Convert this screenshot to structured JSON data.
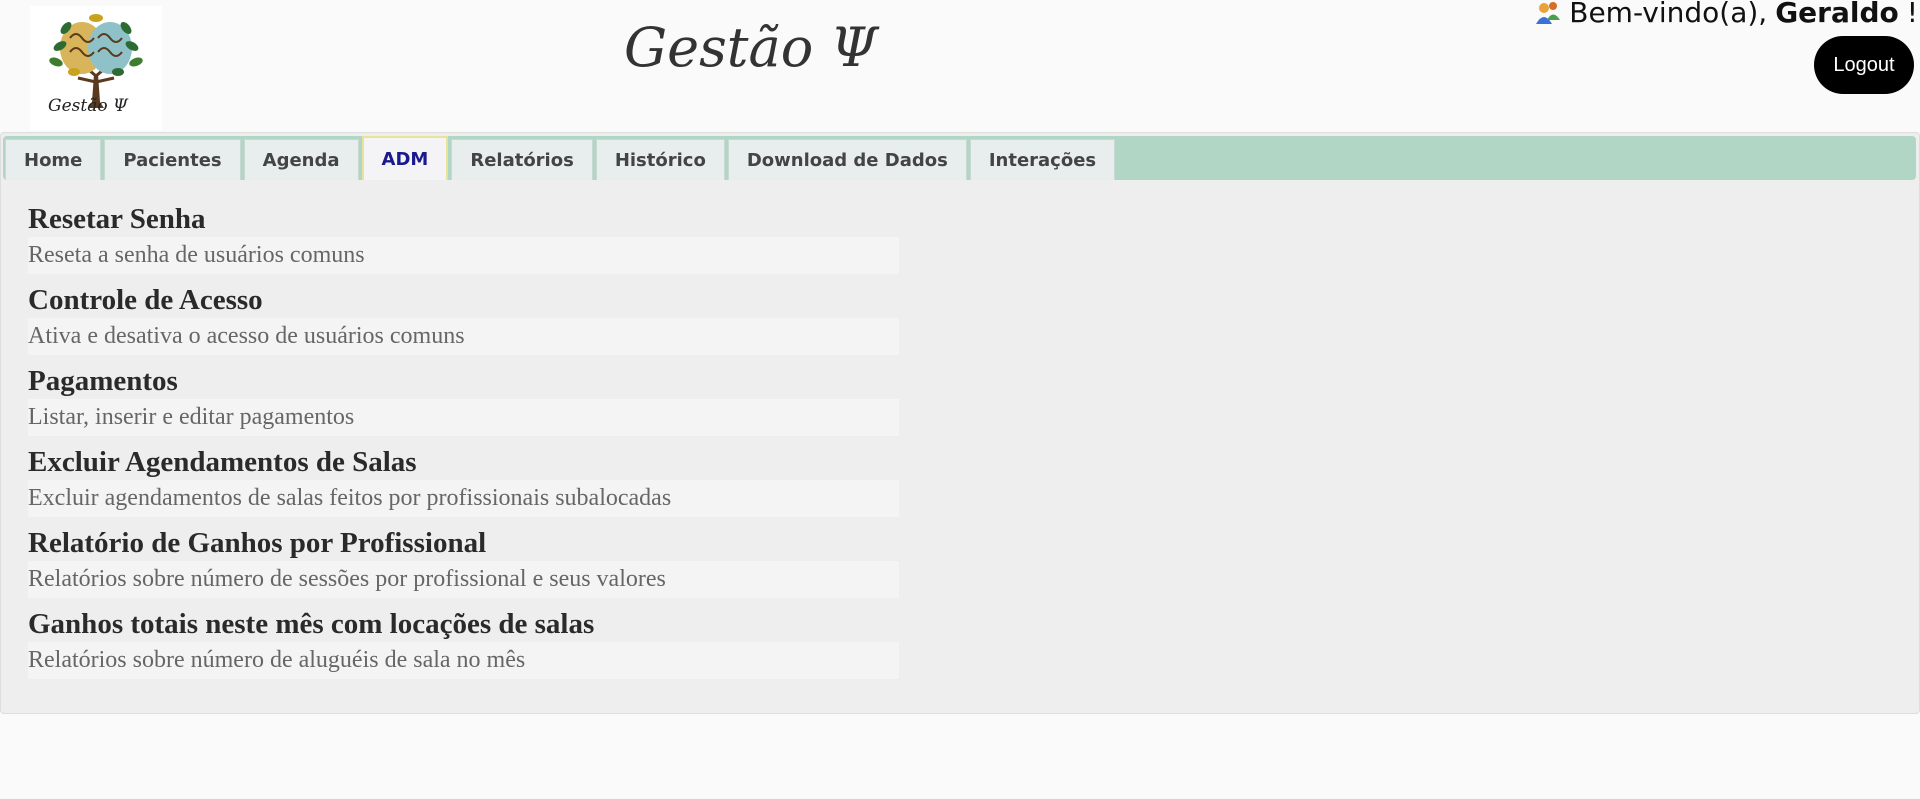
{
  "header": {
    "logo_text": "Gestão Ψ",
    "app_title": "Gestão Ψ",
    "welcome_prefix": "Bem-vindo(a),",
    "user_name": "Geraldo",
    "welcome_suffix": "!",
    "logout_label": "Logout"
  },
  "tabs": [
    {
      "label": "Home",
      "active": false
    },
    {
      "label": "Pacientes",
      "active": false
    },
    {
      "label": "Agenda",
      "active": false
    },
    {
      "label": "ADM",
      "active": true
    },
    {
      "label": "Relatórios",
      "active": false
    },
    {
      "label": "Histórico",
      "active": false
    },
    {
      "label": "Download de Dados",
      "active": false
    },
    {
      "label": "Interações",
      "active": false
    }
  ],
  "admin_items": [
    {
      "title": "Resetar Senha",
      "description": "Reseta a senha de usuários comuns"
    },
    {
      "title": "Controle de Acesso",
      "description": "Ativa e desativa o acesso de usuários comuns"
    },
    {
      "title": "Pagamentos",
      "description": "Listar, inserir e editar pagamentos"
    },
    {
      "title": "Excluir Agendamentos de Salas",
      "description": "Excluir agendamentos de salas feitos por profissionais subalocadas"
    },
    {
      "title": "Relatório de Ganhos por Profissional",
      "description": "Relatórios sobre número de sessões por profissional e seus valores"
    },
    {
      "title": "Ganhos totais neste mês com locações de salas",
      "description": "Relatórios sobre número de aluguéis de sala no mês"
    }
  ],
  "colors": {
    "tabbar_bg": "#b2d6c5",
    "active_tab_text": "#1a1a8c",
    "logout_bg": "#000000"
  },
  "icons": {
    "user": "users-icon",
    "logo": "brain-tree-logo"
  }
}
